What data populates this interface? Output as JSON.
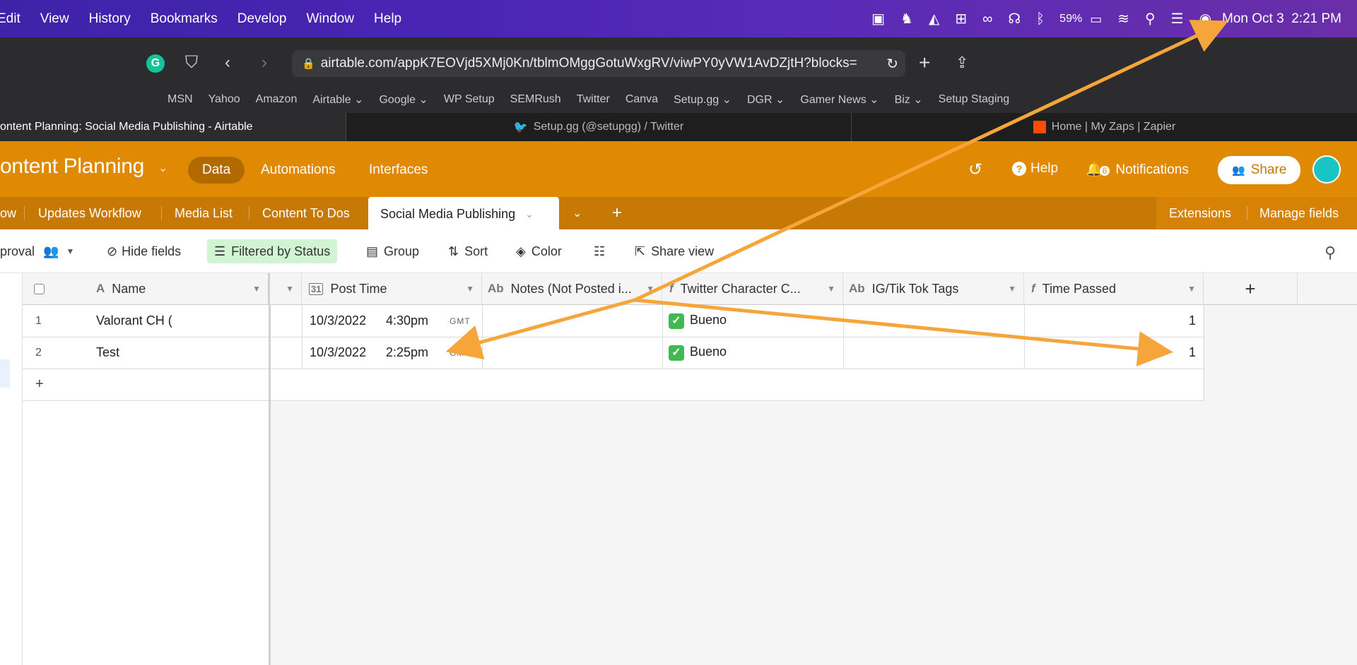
{
  "menubar": {
    "items": [
      "Edit",
      "View",
      "History",
      "Bookmarks",
      "Develop",
      "Window",
      "Help"
    ],
    "battery": "59%",
    "clock": "Mon Oct 3  2:21 PM"
  },
  "browser": {
    "url": "airtable.com/appK7EOVjd5XMj0Kn/tblmOMggGotuWxgRV/viwPY0yVW1AvDZjtH?blocks=",
    "bookmarks": [
      "MSN",
      "Yahoo",
      "Amazon",
      "Airtable ⌄",
      "Google ⌄",
      "WP Setup",
      "SEMRush",
      "Twitter",
      "Canva",
      "Setup.gg ⌄",
      "DGR ⌄",
      "Gamer News ⌄",
      "Biz ⌄",
      "Setup Staging"
    ],
    "tabs": [
      {
        "title": "ontent Planning: Social Media Publishing - Airtable",
        "icon": ""
      },
      {
        "title": "Setup.gg (@setupgg) / Twitter",
        "icon": "twitter-bird-icon"
      },
      {
        "title": "Home | My Zaps | Zapier",
        "icon": "zapier-icon"
      }
    ]
  },
  "airtable": {
    "base_title": "ontent Planning",
    "nav": {
      "data": "Data",
      "automations": "Automations",
      "interfaces": "Interfaces"
    },
    "help": "Help",
    "notifications": "Notifications",
    "notif_count": "6",
    "share": "Share",
    "tables": [
      "ow",
      "Updates Workflow",
      "Media List",
      "Content To Dos",
      "Social Media Publishing"
    ],
    "extensions": "Extensions",
    "manage_fields": "Manage fields",
    "view": {
      "name": "proval",
      "hide_fields": "Hide fields",
      "filtered": "Filtered by Status",
      "group": "Group",
      "sort": "Sort",
      "color": "Color",
      "share_view": "Share view"
    },
    "grid": {
      "columns": [
        "Name",
        "Post Time",
        "Notes (Not Posted i...",
        "Twitter Character C...",
        "IG/Tik Tok Tags",
        "Time Passed"
      ],
      "rows": [
        {
          "num": "1",
          "name": "Valorant CH (",
          "date": "10/3/2022",
          "time": "4:30pm",
          "tz": "GMT",
          "twitter": "Bueno",
          "passed": "1"
        },
        {
          "num": "2",
          "name": "Test",
          "date": "10/3/2022",
          "time": "2:25pm",
          "tz": "GMT",
          "twitter": "Bueno",
          "passed": "1"
        }
      ],
      "add_row": "+",
      "add_column": "+"
    }
  },
  "annotation_color": "#f5a53a"
}
